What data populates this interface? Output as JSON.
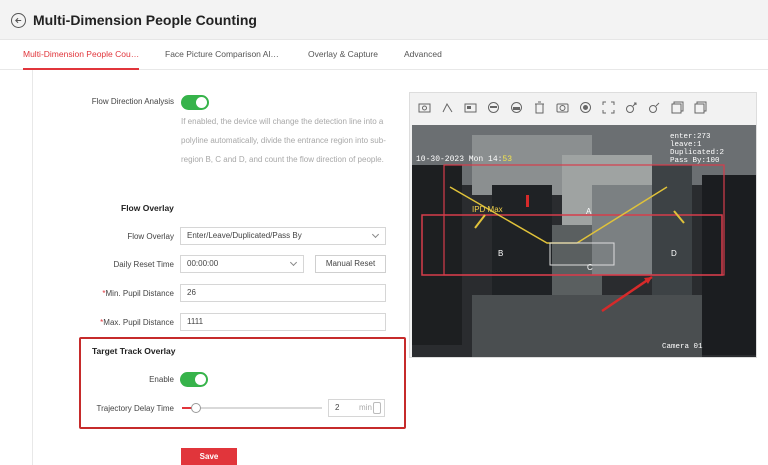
{
  "header": {
    "title": "Multi-Dimension People Counting"
  },
  "tabs": [
    {
      "label": "Multi-Dimension People Cou…",
      "active": true
    },
    {
      "label": "Face Picture Comparison Al…",
      "active": false
    },
    {
      "label": "Overlay & Capture",
      "active": false
    },
    {
      "label": "Advanced",
      "active": false
    }
  ],
  "flow_direction": {
    "label": "Flow Direction Analysis",
    "enabled": true,
    "description": "If enabled, the device will change the detection line into a polyline automatically, divide the entrance region into sub-region B, C and D, and count the flow direction of people."
  },
  "flow_overlay": {
    "section_title": "Flow Overlay",
    "overlay_label": "Flow Overlay",
    "overlay_value": "Enter/Leave/Duplicated/Pass By",
    "reset_label": "Daily Reset Time",
    "reset_value": "00:00:00",
    "manual_reset": "Manual Reset",
    "min_pupil_label": "Min. Pupil Distance",
    "min_pupil_value": "26",
    "max_pupil_label": "Max. Pupil Distance",
    "max_pupil_value": "1111",
    "required_mark": "*"
  },
  "target_track": {
    "section_title": "Target Track Overlay",
    "enable_label": "Enable",
    "enabled": true,
    "delay_label": "Trajectory Delay Time",
    "delay_value": "2",
    "delay_unit": "min",
    "delay_slider_fraction": 0.1
  },
  "save_label": "Save",
  "video": {
    "timestamp": "10-30-2023 Mon 14:",
    "timestamp_tail": "53",
    "overlay_lines": [
      "enter:273",
      "leave:1",
      "Duplicated:2",
      "Pass By:100"
    ],
    "camera_label": "Camera 01",
    "region_labels": [
      "A",
      "B",
      "C",
      "D"
    ],
    "ipd_label": "IPD Max"
  },
  "toolbar_icons": [
    "snapshot-icon",
    "draw-line-icon",
    "region-icon",
    "face-icon",
    "target-icon",
    "delete-icon",
    "capture-icon",
    "record-icon",
    "fullscreen-icon",
    "zoom-in-icon",
    "zoom-out-icon",
    "window-icon",
    "window-alt-icon"
  ],
  "colors": {
    "accent": "#e1353b",
    "toggle_on": "#36b34a"
  }
}
